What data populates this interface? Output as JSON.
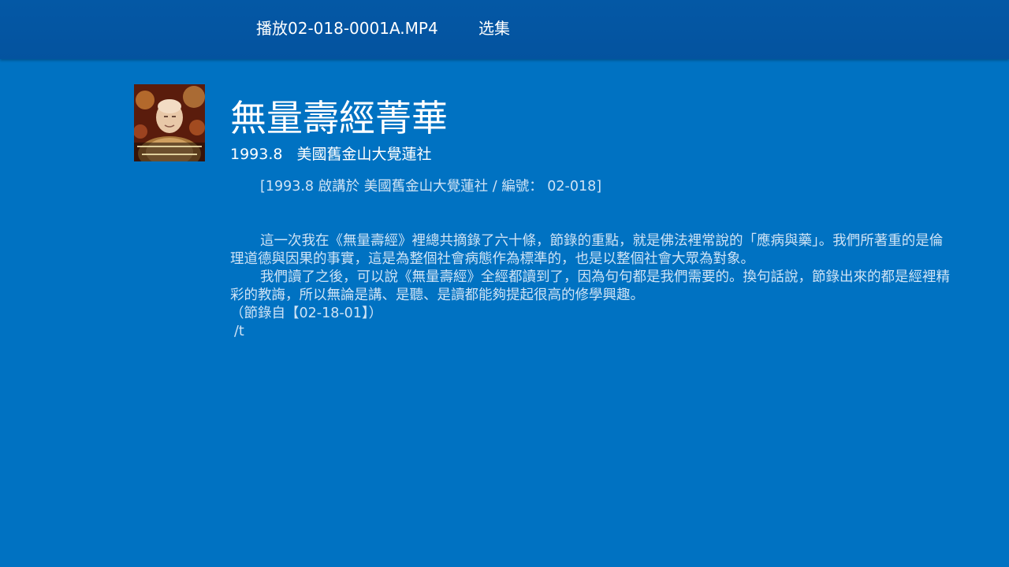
{
  "topbar": {
    "play_label": "播放02-018-0001A.MP4",
    "episodes_label": "选集"
  },
  "video": {
    "title": "無量壽經菁華",
    "date": "1993.8",
    "location": "美國舊金山大覺蓮社",
    "meta_line": "[1993.8 啟講於 美國舊金山大覺蓮社 / 編號： 02-018]",
    "paragraph_1": "這一次我在《無量壽經》裡總共摘錄了六十條，節錄的重點，就是佛法裡常說的「應病與藥」。我們所著重的是倫理道德與因果的事實，這是為整個社會病態作為標準的，也是以整個社會大眾為對象。",
    "paragraph_2": "我們讀了之後，可以說《無量壽經》全經都讀到了，因為句句都是我們需要的。換句話說，節錄出來的都是經裡精彩的教誨，所以無論是講、是聽、是讀都能夠提起很高的修學興趣。",
    "source_note": "（節錄自【02-18-01】）",
    "trailing_text": "/t"
  },
  "icons": {
    "thumbnail": "video-thumbnail-image"
  }
}
